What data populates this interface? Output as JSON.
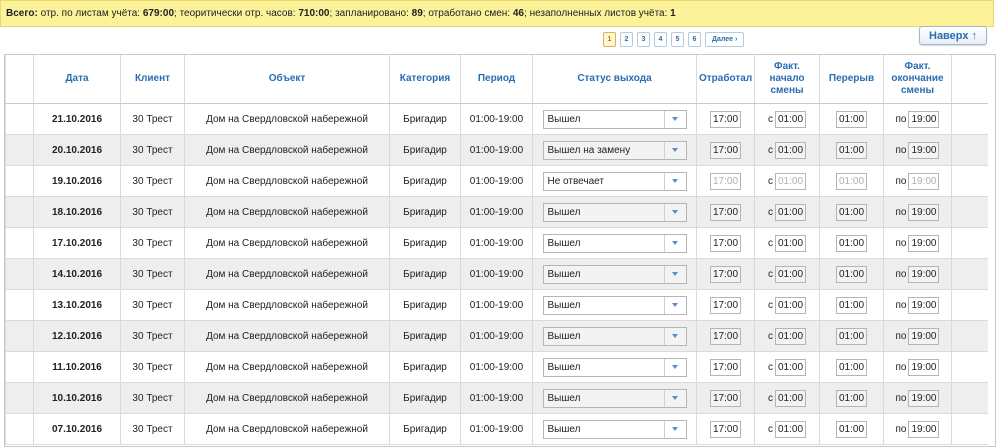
{
  "summary": {
    "lead": "Всего:",
    "items": [
      {
        "label": "отр. по листам учёта:",
        "value": "679:00"
      },
      {
        "label": "теоритически отр. часов:",
        "value": "710:00"
      },
      {
        "label": "запланировано:",
        "value": "89"
      },
      {
        "label": "отработано смен:",
        "value": "46"
      },
      {
        "label": "незаполненных листов учёта:",
        "value": "1"
      }
    ]
  },
  "top_button": {
    "label": "Наверх",
    "icon": "arrow-up-icon",
    "glyph": "↑"
  },
  "pager": {
    "pages": [
      "1",
      "2",
      "3",
      "4",
      "5",
      "6"
    ],
    "active": "1",
    "next_label": "Далее ›"
  },
  "columns": [
    "Дата",
    "Клиент",
    "Объект",
    "Категория",
    "Период",
    "Статус выхода",
    "Отработал",
    "Факт. начало смены",
    "Перерыв",
    "Факт. окончание смены"
  ],
  "start_prefix": "с",
  "end_prefix": "по",
  "rows": [
    {
      "date": "21.10.2016",
      "client": "30 Трест",
      "object": "Дом на Свердловской набережной",
      "category": "Бригадир",
      "period": "01:00-19:00",
      "status": "Вышел",
      "worked": "17:00",
      "start": "01:00",
      "break": "01:00",
      "end": "19:00",
      "dim": false
    },
    {
      "date": "20.10.2016",
      "client": "30 Трест",
      "object": "Дом на Свердловской набережной",
      "category": "Бригадир",
      "period": "01:00-19:00",
      "status": "Вышел на замену",
      "worked": "17:00",
      "start": "01:00",
      "break": "01:00",
      "end": "19:00",
      "dim": false
    },
    {
      "date": "19.10.2016",
      "client": "30 Трест",
      "object": "Дом на Свердловской набережной",
      "category": "Бригадир",
      "period": "01:00-19:00",
      "status": "Не отвечает",
      "worked": "17:00",
      "start": "01:00",
      "break": "01:00",
      "end": "19:00",
      "dim": true
    },
    {
      "date": "18.10.2016",
      "client": "30 Трест",
      "object": "Дом на Свердловской набережной",
      "category": "Бригадир",
      "period": "01:00-19:00",
      "status": "Вышел",
      "worked": "17:00",
      "start": "01:00",
      "break": "01:00",
      "end": "19:00",
      "dim": false
    },
    {
      "date": "17.10.2016",
      "client": "30 Трест",
      "object": "Дом на Свердловской набережной",
      "category": "Бригадир",
      "period": "01:00-19:00",
      "status": "Вышел",
      "worked": "17:00",
      "start": "01:00",
      "break": "01:00",
      "end": "19:00",
      "dim": false
    },
    {
      "date": "14.10.2016",
      "client": "30 Трест",
      "object": "Дом на Свердловской набережной",
      "category": "Бригадир",
      "period": "01:00-19:00",
      "status": "Вышел",
      "worked": "17:00",
      "start": "01:00",
      "break": "01:00",
      "end": "19:00",
      "dim": false
    },
    {
      "date": "13.10.2016",
      "client": "30 Трест",
      "object": "Дом на Свердловской набережной",
      "category": "Бригадир",
      "period": "01:00-19:00",
      "status": "Вышел",
      "worked": "17:00",
      "start": "01:00",
      "break": "01:00",
      "end": "19:00",
      "dim": false
    },
    {
      "date": "12.10.2016",
      "client": "30 Трест",
      "object": "Дом на Свердловской набережной",
      "category": "Бригадир",
      "period": "01:00-19:00",
      "status": "Вышел",
      "worked": "17:00",
      "start": "01:00",
      "break": "01:00",
      "end": "19:00",
      "dim": false
    },
    {
      "date": "11.10.2016",
      "client": "30 Трест",
      "object": "Дом на Свердловской набережной",
      "category": "Бригадир",
      "period": "01:00-19:00",
      "status": "Вышел",
      "worked": "17:00",
      "start": "01:00",
      "break": "01:00",
      "end": "19:00",
      "dim": false
    },
    {
      "date": "10.10.2016",
      "client": "30 Трест",
      "object": "Дом на Свердловской набережной",
      "category": "Бригадир",
      "period": "01:00-19:00",
      "status": "Вышел",
      "worked": "17:00",
      "start": "01:00",
      "break": "01:00",
      "end": "19:00",
      "dim": false
    },
    {
      "date": "07.10.2016",
      "client": "30 Трест",
      "object": "Дом на Свердловской набережной",
      "category": "Бригадир",
      "period": "01:00-19:00",
      "status": "Вышел",
      "worked": "17:00",
      "start": "01:00",
      "break": "01:00",
      "end": "19:00",
      "dim": false
    }
  ]
}
